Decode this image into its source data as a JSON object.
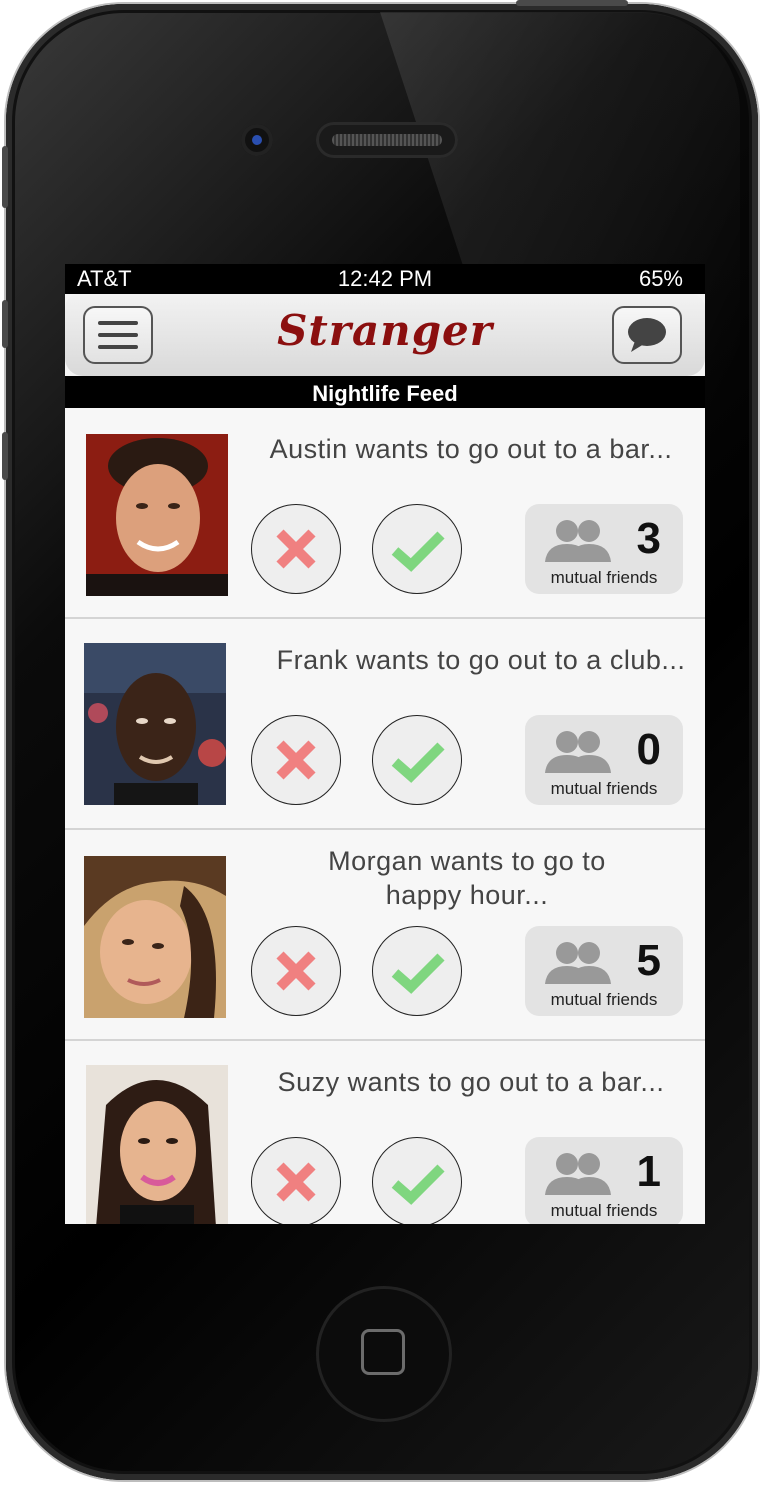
{
  "status": {
    "carrier": "AT&T",
    "time": "12:42 PM",
    "battery": "65%"
  },
  "header": {
    "title": "Stranger",
    "menu_icon": "menu-icon",
    "chat_icon": "chat-bubble-icon"
  },
  "subheader": {
    "label": "Nightlife Feed"
  },
  "colors": {
    "title": "#8b0f0f",
    "reject": "#f08080",
    "accept": "#7fd67f"
  },
  "feed": [
    {
      "name": "Austin",
      "message": "Austin wants to go out to a bar...",
      "mutual_count": "3",
      "mutual_label": "mutual friends"
    },
    {
      "name": "Frank",
      "message": "Frank wants to go out to a club...",
      "mutual_count": "0",
      "mutual_label": "mutual friends"
    },
    {
      "name": "Morgan",
      "message": "Morgan wants to go to happy hour...",
      "mutual_count": "5",
      "mutual_label": "mutual friends"
    },
    {
      "name": "Suzy",
      "message": "Suzy wants to go out to a bar...",
      "mutual_count": "1",
      "mutual_label": "mutual friends"
    }
  ]
}
